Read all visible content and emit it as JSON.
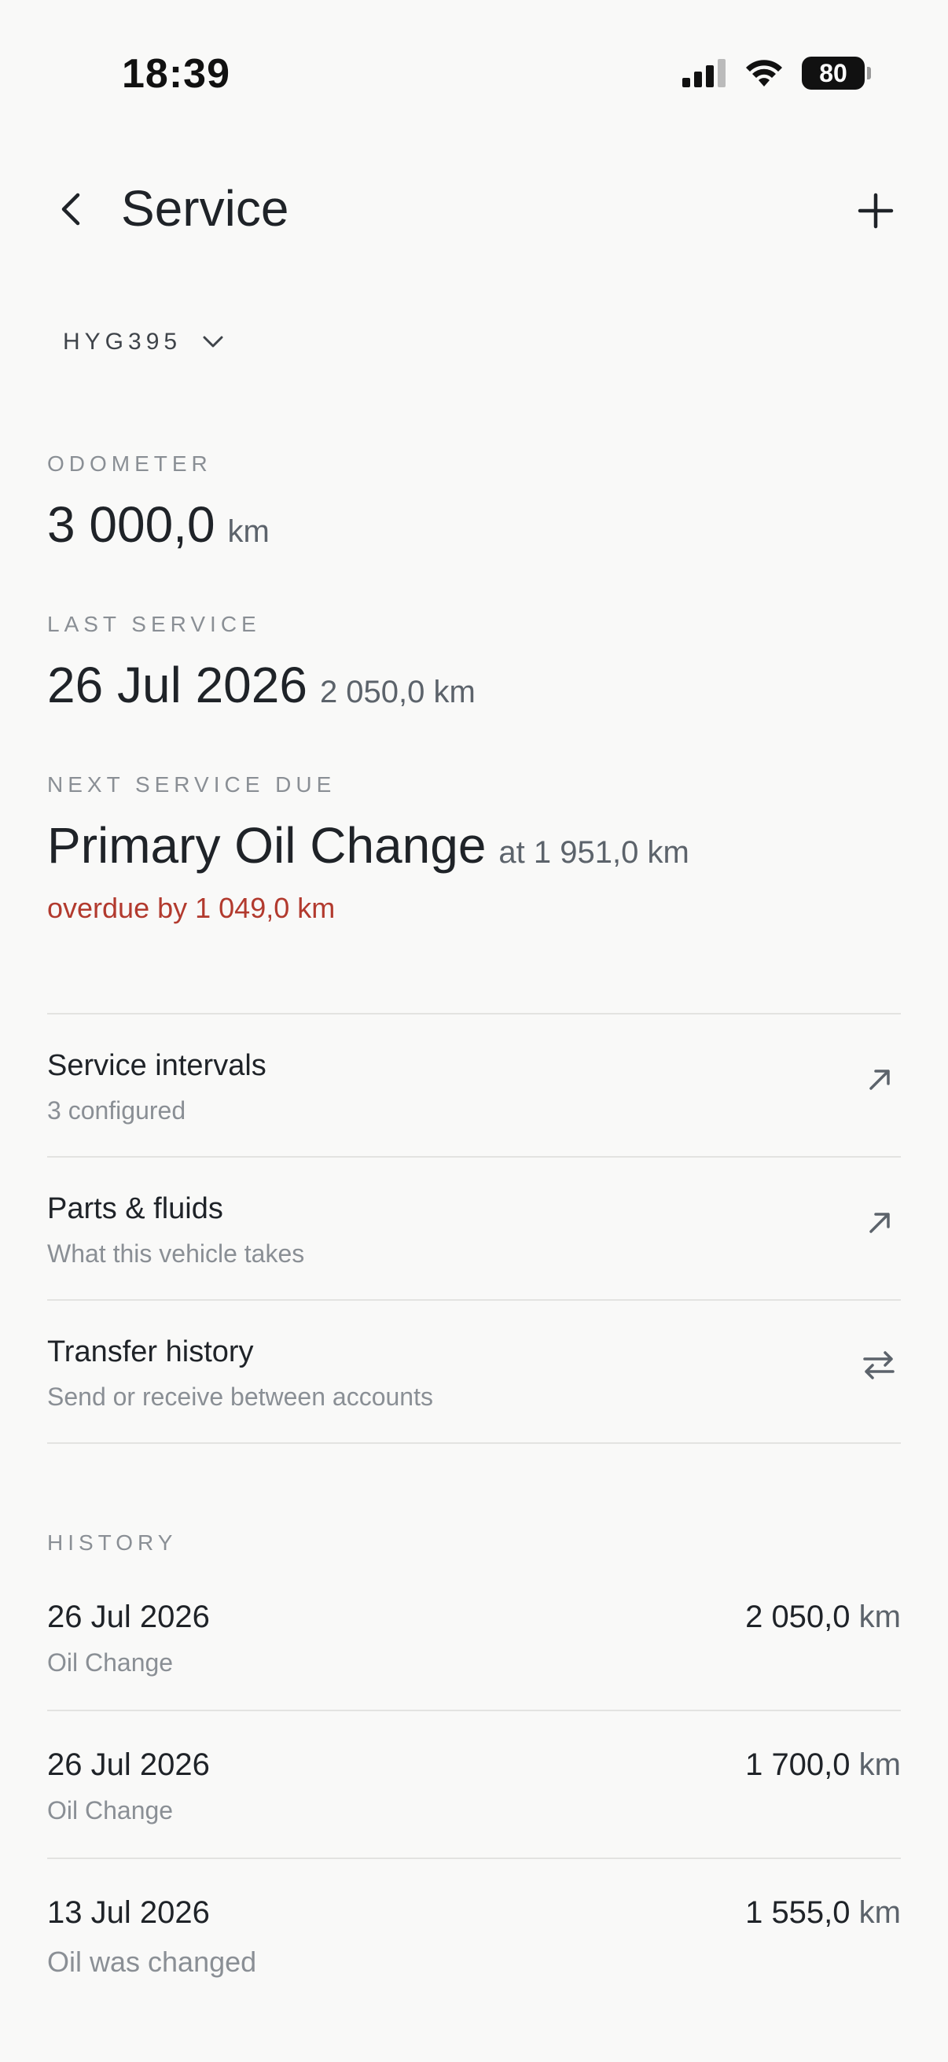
{
  "status_bar": {
    "time": "18:39",
    "battery": "80"
  },
  "header": {
    "title": "Service"
  },
  "vehicle": {
    "plate": "HYG395"
  },
  "odometer": {
    "label": "ODOMETER",
    "value": "3 000,0",
    "unit": "km"
  },
  "last_service": {
    "label": "LAST SERVICE",
    "date": "26 Jul 2026",
    "km": "2 050,0 km"
  },
  "next_service": {
    "label": "NEXT SERVICE DUE",
    "name": "Primary Oil Change",
    "at": "at 1 951,0 km",
    "overdue": "overdue by 1 049,0 km"
  },
  "links": [
    {
      "title": "Service intervals",
      "subtitle": "3 configured",
      "icon": "arrow-up-right-icon"
    },
    {
      "title": "Parts & fluids",
      "subtitle": "What this vehicle takes",
      "icon": "arrow-up-right-icon"
    },
    {
      "title": "Transfer history",
      "subtitle": "Send or receive between accounts",
      "icon": "swap-arrows-icon"
    }
  ],
  "history": {
    "label": "HISTORY",
    "items": [
      {
        "date": "26 Jul 2026",
        "desc": "Oil Change",
        "km": "2 050,0",
        "unit": "km"
      },
      {
        "date": "26 Jul 2026",
        "desc": "Oil Change",
        "km": "1 700,0",
        "unit": "km"
      },
      {
        "date": "13 Jul 2026",
        "desc": "Oil was changed",
        "km": "1 555,0",
        "unit": "km"
      }
    ]
  },
  "colors": {
    "overdue": "#b23a2e",
    "background": "#f9f9f8"
  }
}
